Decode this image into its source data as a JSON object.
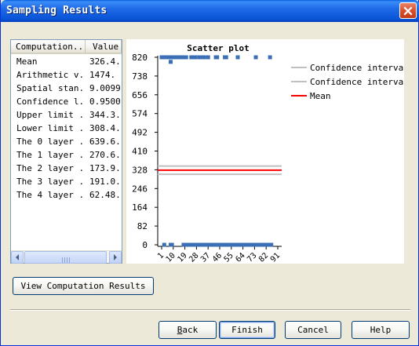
{
  "window": {
    "title": "Sampling Results"
  },
  "table": {
    "columns": [
      "Computation...",
      "Value"
    ],
    "rows": [
      [
        "Mean",
        "326.4."
      ],
      [
        "Arithmetic v...",
        "1474."
      ],
      [
        "Spatial stan...",
        "9.0099"
      ],
      [
        "Confidence l...",
        "0.9500"
      ],
      [
        "Upper limit ...",
        "344.3."
      ],
      [
        "Lower limit ...",
        "308.4."
      ],
      [
        "The 0 layer ...",
        "639.6."
      ],
      [
        "The 1 layer ...",
        "270.6."
      ],
      [
        "The 2 layer ...",
        "173.9."
      ],
      [
        "The 3 layer ...",
        "191.0."
      ],
      [
        "The 4 layer ...",
        "62.48."
      ]
    ]
  },
  "chart_data": {
    "type": "scatter",
    "title": "Scatter plot",
    "xlabel": "",
    "ylabel": "",
    "ylim": [
      0,
      820
    ],
    "y_ticks": [
      0,
      82,
      164,
      246,
      328,
      410,
      492,
      574,
      656,
      738,
      820
    ],
    "x_ticks": [
      "1",
      "10",
      "19",
      "28",
      "37",
      "46",
      "55",
      "64",
      "73",
      "82",
      "91"
    ],
    "xlim": [
      1,
      91
    ],
    "grid": false,
    "legend_position": "right",
    "series": [
      {
        "name": "Confidence interval",
        "kind": "hline",
        "color": "#c0c0c0",
        "y": 344.3
      },
      {
        "name": "Confidence interval",
        "kind": "hline",
        "color": "#c0c0c0",
        "y": 308.4
      },
      {
        "name": "Mean",
        "kind": "hline",
        "color": "#ff0000",
        "y": 326.4
      },
      {
        "name": "",
        "kind": "points",
        "color": "#3a6fb5",
        "points": [
          [
            1,
            820
          ],
          [
            2,
            820
          ],
          [
            3,
            820
          ],
          [
            4,
            820
          ],
          [
            5,
            820
          ],
          [
            6,
            820
          ],
          [
            7,
            820
          ],
          [
            8,
            800
          ],
          [
            9,
            820
          ],
          [
            10,
            820
          ],
          [
            11,
            820
          ],
          [
            12,
            820
          ],
          [
            13,
            820
          ],
          [
            14,
            820
          ],
          [
            15,
            820
          ],
          [
            16,
            820
          ],
          [
            17,
            820
          ],
          [
            18,
            820
          ],
          [
            19,
            820
          ],
          [
            20,
            820
          ],
          [
            24,
            820
          ],
          [
            25,
            820
          ],
          [
            26,
            820
          ],
          [
            27,
            820
          ],
          [
            30,
            820
          ],
          [
            31,
            820
          ],
          [
            32,
            820
          ],
          [
            33,
            820
          ],
          [
            34,
            820
          ],
          [
            37,
            820
          ],
          [
            43,
            820
          ],
          [
            44,
            820
          ],
          [
            50,
            820
          ],
          [
            51,
            820
          ],
          [
            60,
            820
          ],
          [
            74,
            820
          ],
          [
            85,
            820
          ],
          [
            3,
            0
          ],
          [
            8,
            0
          ],
          [
            9,
            0
          ],
          [
            18,
            0
          ],
          [
            19,
            0
          ],
          [
            20,
            0
          ],
          [
            21,
            0
          ],
          [
            22,
            0
          ],
          [
            23,
            0
          ],
          [
            24,
            0
          ],
          [
            25,
            0
          ],
          [
            26,
            0
          ],
          [
            27,
            0
          ],
          [
            28,
            0
          ],
          [
            29,
            0
          ],
          [
            30,
            0
          ],
          [
            31,
            0
          ],
          [
            32,
            0
          ],
          [
            33,
            0
          ],
          [
            34,
            0
          ],
          [
            35,
            0
          ],
          [
            36,
            0
          ],
          [
            37,
            0
          ],
          [
            38,
            0
          ],
          [
            39,
            0
          ],
          [
            40,
            0
          ],
          [
            41,
            0
          ],
          [
            42,
            0
          ],
          [
            43,
            0
          ],
          [
            44,
            0
          ],
          [
            45,
            0
          ],
          [
            46,
            0
          ],
          [
            47,
            0
          ],
          [
            48,
            0
          ],
          [
            49,
            0
          ],
          [
            50,
            0
          ],
          [
            51,
            0
          ],
          [
            52,
            0
          ],
          [
            53,
            0
          ],
          [
            54,
            0
          ],
          [
            55,
            0
          ],
          [
            56,
            0
          ],
          [
            57,
            0
          ],
          [
            58,
            0
          ],
          [
            59,
            0
          ],
          [
            60,
            0
          ],
          [
            61,
            0
          ],
          [
            62,
            0
          ],
          [
            63,
            0
          ],
          [
            64,
            0
          ],
          [
            65,
            0
          ],
          [
            66,
            0
          ],
          [
            67,
            0
          ],
          [
            68,
            0
          ],
          [
            69,
            0
          ],
          [
            70,
            0
          ],
          [
            71,
            0
          ],
          [
            72,
            0
          ],
          [
            73,
            0
          ],
          [
            74,
            0
          ],
          [
            75,
            0
          ],
          [
            76,
            0
          ],
          [
            77,
            0
          ],
          [
            78,
            0
          ],
          [
            79,
            0
          ],
          [
            80,
            0
          ],
          [
            81,
            0
          ],
          [
            82,
            0
          ],
          [
            83,
            0
          ],
          [
            84,
            0
          ],
          [
            85,
            0
          ],
          [
            86,
            0
          ]
        ]
      }
    ]
  },
  "buttons": {
    "view": "View Computation Results",
    "back": "Back",
    "finish": "Finish",
    "cancel": "Cancel",
    "help": "Help"
  },
  "colors": {
    "titlebar": "#0a55d8",
    "dialog_bg": "#ece9d8",
    "point": "#3a6fb5",
    "mean": "#ff0000",
    "ci": "#c0c0c0"
  }
}
